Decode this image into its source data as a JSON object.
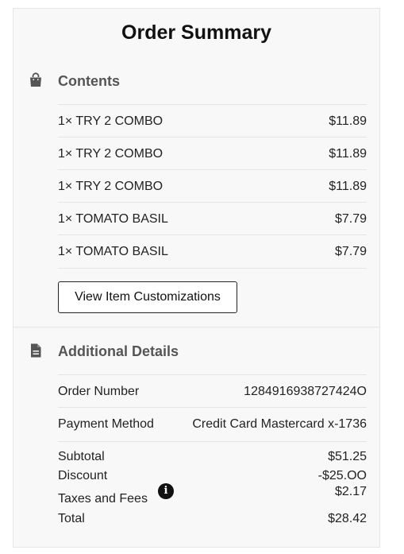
{
  "header": {
    "title": "Order Summary"
  },
  "contents": {
    "title": "Contents",
    "icon": "shopping-bag-icon",
    "items": [
      {
        "label": "1× TRY 2 COMBO",
        "price": "$11.89"
      },
      {
        "label": "1× TRY 2 COMBO",
        "price": "$11.89"
      },
      {
        "label": "1× TRY 2 COMBO",
        "price": "$11.89"
      },
      {
        "label": "1× TOMATO BASIL",
        "price": "$7.79"
      },
      {
        "label": "1× TOMATO BASIL",
        "price": "$7.79"
      }
    ],
    "view_button_label": "View Item Customizations"
  },
  "details": {
    "title": "Additional Details",
    "icon": "document-icon",
    "order_number_label": "Order Number",
    "order_number": "1284916938727424O",
    "payment_label": "Payment Method",
    "payment_value": "Credit Card Mastercard x-1736"
  },
  "totals": {
    "subtotal_label": "Subtotal",
    "subtotal": "$51.25",
    "discount_label": "Discount",
    "discount": "-$25.OO",
    "taxes_label": "Taxes and Fees",
    "taxes": "$2.17",
    "info_icon": "info-icon",
    "total_label": "Total",
    "total": "$28.42"
  }
}
